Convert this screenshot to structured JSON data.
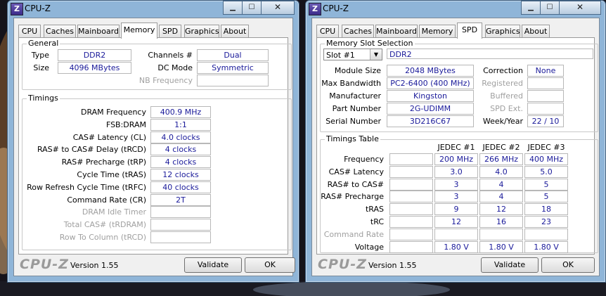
{
  "colors": {
    "value_text": "#1a1a9a",
    "titlebar": "#8fb5d8",
    "dim_label": "#a0a0a0"
  },
  "left_window": {
    "title": "CPU-Z",
    "app_icon": "Z",
    "tabs": [
      "CPU",
      "Caches",
      "Mainboard",
      "Memory",
      "SPD",
      "Graphics",
      "About"
    ],
    "active_tab": "Memory",
    "general": {
      "title": "General",
      "type_label": "Type",
      "type_value": "DDR2",
      "size_label": "Size",
      "size_value": "4096 MBytes",
      "channels_label": "Channels #",
      "channels_value": "Dual",
      "dcmode_label": "DC Mode",
      "dcmode_value": "Symmetric",
      "nbfreq_label": "NB Frequency",
      "nbfreq_value": ""
    },
    "timings": {
      "title": "Timings",
      "rows": [
        {
          "label": "DRAM Frequency",
          "value": "400.9 MHz",
          "dim": false
        },
        {
          "label": "FSB:DRAM",
          "value": "1:1",
          "dim": false
        },
        {
          "label": "CAS# Latency (CL)",
          "value": "4.0 clocks",
          "dim": false
        },
        {
          "label": "RAS# to CAS# Delay (tRCD)",
          "value": "4 clocks",
          "dim": false
        },
        {
          "label": "RAS# Precharge (tRP)",
          "value": "4 clocks",
          "dim": false
        },
        {
          "label": "Cycle Time (tRAS)",
          "value": "12 clocks",
          "dim": false
        },
        {
          "label": "Row Refresh Cycle Time (tRFC)",
          "value": "40 clocks",
          "dim": false
        },
        {
          "label": "Command Rate (CR)",
          "value": "2T",
          "dim": false
        },
        {
          "label": "DRAM Idle Timer",
          "value": "",
          "dim": true
        },
        {
          "label": "Total CAS# (tRDRAM)",
          "value": "",
          "dim": true
        },
        {
          "label": "Row To Column (tRCD)",
          "value": "",
          "dim": true
        }
      ]
    },
    "footer": {
      "brand": "CPU-Z",
      "version": "Version 1.55",
      "validate": "Validate",
      "ok": "OK"
    }
  },
  "right_window": {
    "title": "CPU-Z",
    "app_icon": "Z",
    "tabs": [
      "CPU",
      "Caches",
      "Mainboard",
      "Memory",
      "SPD",
      "Graphics",
      "About"
    ],
    "active_tab": "SPD",
    "slot": {
      "title": "Memory Slot Selection",
      "selected": "Slot #1",
      "type": "DDR2",
      "module_size_label": "Module Size",
      "module_size": "2048 MBytes",
      "max_bw_label": "Max Bandwidth",
      "max_bw": "PC2-6400 (400 MHz)",
      "manufacturer_label": "Manufacturer",
      "manufacturer": "Kingston",
      "part_label": "Part Number",
      "part": "2G-UDIMM",
      "serial_label": "Serial Number",
      "serial": "3D216C67",
      "correction_label": "Correction",
      "correction": "None",
      "registered_label": "Registered",
      "registered": "",
      "buffered_label": "Buffered",
      "buffered": "",
      "spdext_label": "SPD Ext.",
      "spdext": "",
      "weekyear_label": "Week/Year",
      "weekyear": "22 / 10"
    },
    "timings_table": {
      "title": "Timings Table",
      "columns": [
        "JEDEC #1",
        "JEDEC #2",
        "JEDEC #3"
      ],
      "rows": [
        {
          "label": "Frequency",
          "values": [
            "200 MHz",
            "266 MHz",
            "400 MHz"
          ],
          "dim": false
        },
        {
          "label": "CAS# Latency",
          "values": [
            "3.0",
            "4.0",
            "5.0"
          ],
          "dim": false
        },
        {
          "label": "RAS# to CAS#",
          "values": [
            "3",
            "4",
            "5"
          ],
          "dim": false
        },
        {
          "label": "RAS# Precharge",
          "values": [
            "3",
            "4",
            "5"
          ],
          "dim": false
        },
        {
          "label": "tRAS",
          "values": [
            "9",
            "12",
            "18"
          ],
          "dim": false
        },
        {
          "label": "tRC",
          "values": [
            "12",
            "16",
            "23"
          ],
          "dim": false
        },
        {
          "label": "Command Rate",
          "values": [
            "",
            "",
            ""
          ],
          "dim": true
        },
        {
          "label": "Voltage",
          "values": [
            "1.80 V",
            "1.80 V",
            "1.80 V"
          ],
          "dim": false
        }
      ]
    },
    "footer": {
      "brand": "CPU-Z",
      "version": "Version 1.55",
      "validate": "Validate",
      "ok": "OK"
    }
  }
}
